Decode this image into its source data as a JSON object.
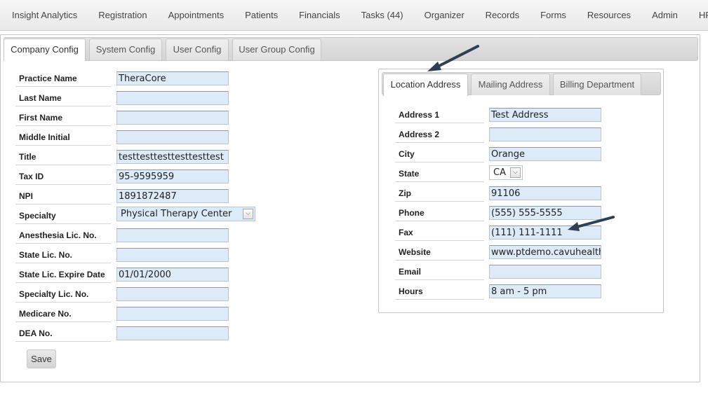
{
  "nav": [
    {
      "label": "Insight Analytics",
      "name": "nav-insight-analytics"
    },
    {
      "label": "Registration",
      "name": "nav-registration"
    },
    {
      "label": "Appointments",
      "name": "nav-appointments"
    },
    {
      "label": "Patients",
      "name": "nav-patients"
    },
    {
      "label": "Financials",
      "name": "nav-financials"
    },
    {
      "label": "Tasks (44)",
      "name": "nav-tasks"
    },
    {
      "label": "Organizer",
      "name": "nav-organizer"
    },
    {
      "label": "Records",
      "name": "nav-records"
    },
    {
      "label": "Forms",
      "name": "nav-forms"
    },
    {
      "label": "Resources",
      "name": "nav-resources"
    },
    {
      "label": "Admin",
      "name": "nav-admin"
    },
    {
      "label": "HR",
      "name": "nav-hr"
    }
  ],
  "main_tabs": {
    "company": "Company Config",
    "system": "System Config",
    "user": "User Config",
    "user_group": "User Group Config",
    "active": "Company Config"
  },
  "company_form": {
    "practice_name": {
      "label": "Practice Name",
      "value": "TheraCore"
    },
    "last_name": {
      "label": "Last Name",
      "value": ""
    },
    "first_name": {
      "label": "First Name",
      "value": ""
    },
    "middle_initial": {
      "label": "Middle Initial",
      "value": ""
    },
    "title": {
      "label": "Title",
      "value": "testtesttesttesttesttest"
    },
    "tax_id": {
      "label": "Tax ID",
      "value": "95-9595959"
    },
    "npi": {
      "label": "NPI",
      "value": "1891872487"
    },
    "specialty": {
      "label": "Specialty",
      "value": "Physical Therapy Center"
    },
    "anesthesia_lic": {
      "label": "Anesthesia Lic. No.",
      "value": ""
    },
    "state_lic": {
      "label": "State Lic. No.",
      "value": ""
    },
    "state_lic_expire": {
      "label": "State Lic. Expire Date",
      "value": "01/01/2000"
    },
    "specialty_lic": {
      "label": "Specialty Lic. No.",
      "value": ""
    },
    "medicare": {
      "label": "Medicare No.",
      "value": ""
    },
    "dea": {
      "label": "DEA No.",
      "value": ""
    },
    "save_label": "Save"
  },
  "address_tabs": {
    "location": "Location Address",
    "mailing": "Mailing Address",
    "billing": "Billing Department",
    "active": "Location Address"
  },
  "address_form": {
    "address1": {
      "label": "Address 1",
      "value": "Test Address"
    },
    "address2": {
      "label": "Address 2",
      "value": ""
    },
    "city": {
      "label": "City",
      "value": "Orange"
    },
    "state": {
      "label": "State",
      "value": "CA"
    },
    "zip": {
      "label": "Zip",
      "value": "91106"
    },
    "phone": {
      "label": "Phone",
      "value": "(555) 555-5555"
    },
    "fax": {
      "label": "Fax",
      "value": "(111) 111-1111"
    },
    "website": {
      "label": "Website",
      "value": "www.ptdemo.cavuhealth"
    },
    "email": {
      "label": "Email",
      "value": ""
    },
    "hours": {
      "label": "Hours",
      "value": "8 am - 5 pm"
    }
  },
  "icons": {
    "select_arrow": "chevron-down-icon",
    "annotation": "arrow-annotation"
  },
  "colors": {
    "input_bg": "#dcebf7",
    "annotation_arrow": "#2e3f56"
  }
}
